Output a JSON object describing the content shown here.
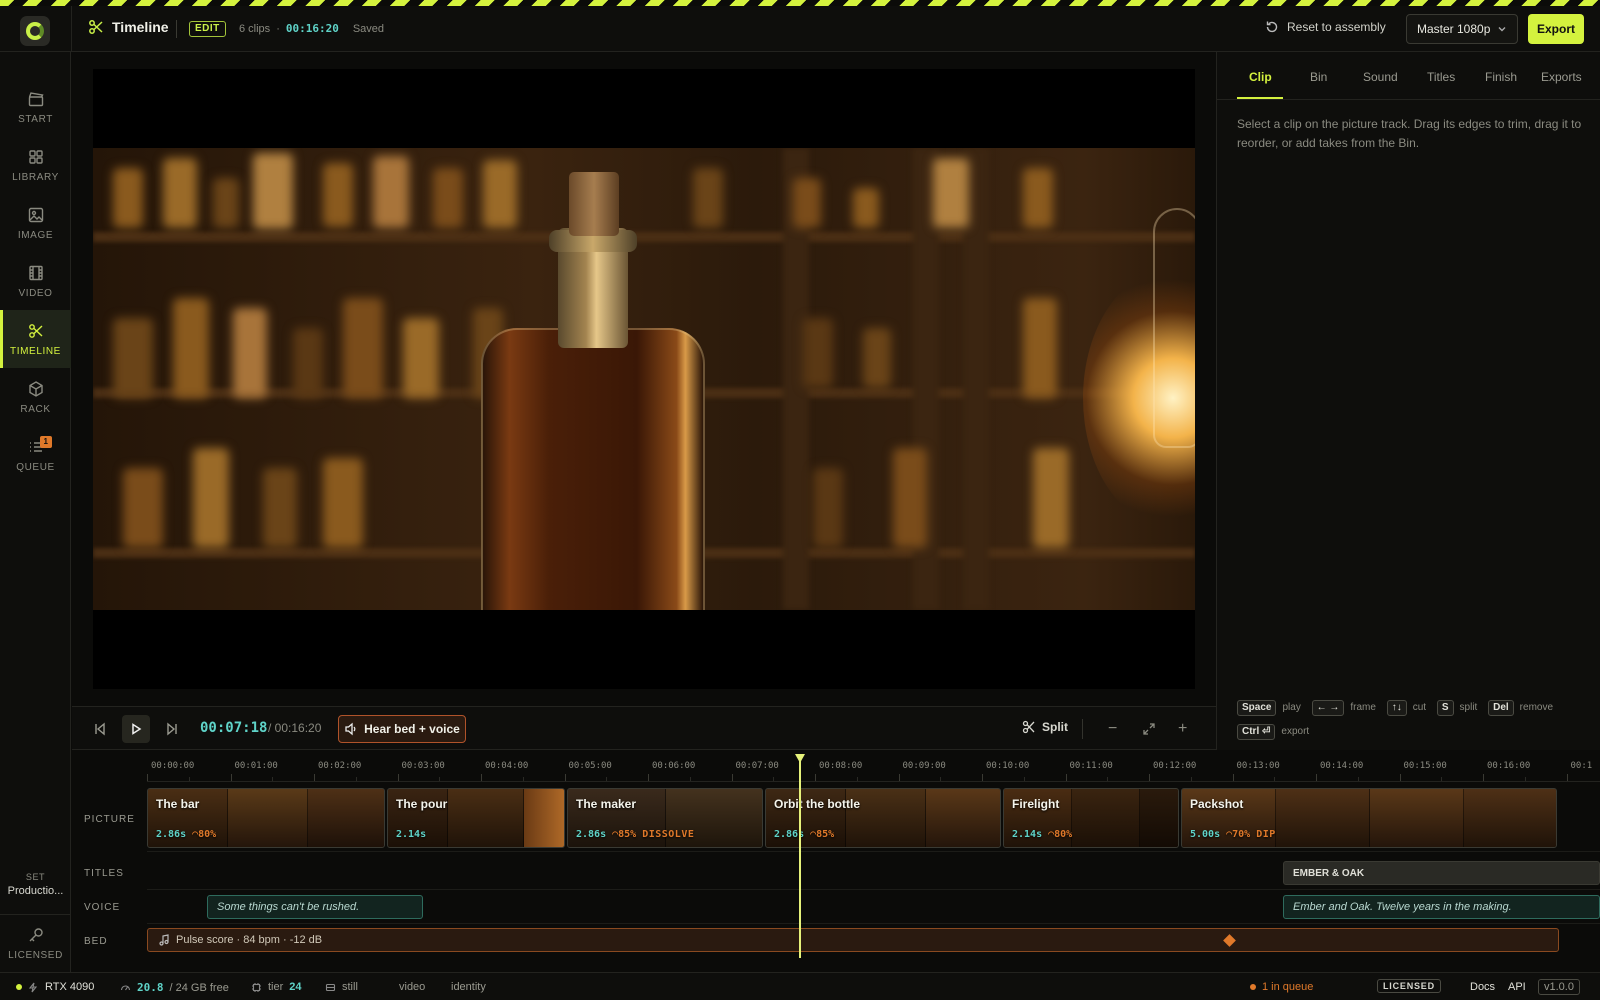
{
  "header": {
    "title": "Timeline",
    "mode_badge": "EDIT",
    "clip_count": "6 clips",
    "total_time": "00:16:20",
    "save_status": "Saved",
    "reset_label": "Reset to assembly",
    "preset": "Master 1080p",
    "export_label": "Export"
  },
  "sidebar": {
    "items": [
      {
        "label": "START",
        "icon": "clapper-icon"
      },
      {
        "label": "LIBRARY",
        "icon": "grid-icon"
      },
      {
        "label": "IMAGE",
        "icon": "image-icon"
      },
      {
        "label": "VIDEO",
        "icon": "film-icon"
      },
      {
        "label": "TIMELINE",
        "icon": "scissors-icon",
        "active": true
      },
      {
        "label": "RACK",
        "icon": "cube-icon"
      },
      {
        "label": "QUEUE",
        "icon": "list-icon",
        "badge": "1"
      }
    ],
    "set_label": "SET",
    "set_value": "Productio...",
    "license_label": "LICENSED"
  },
  "panel": {
    "tabs": [
      "Clip",
      "Bin",
      "Sound",
      "Titles",
      "Finish",
      "Exports"
    ],
    "active_tab": "Clip",
    "hint": "Select a clip on the picture track. Drag its edges to trim, drag it to reorder, or add takes from the Bin.",
    "shortcuts": [
      {
        "key": "Space",
        "action": "play"
      },
      {
        "key": "← →",
        "action": "frame"
      },
      {
        "key": "↑↓",
        "action": "cut"
      },
      {
        "key": "S",
        "action": "split"
      },
      {
        "key": "Del",
        "action": "remove"
      },
      {
        "key": "Ctrl ⏎",
        "action": "export"
      }
    ]
  },
  "transport": {
    "timecode": "00:07:18",
    "duration": "/ 00:16:20",
    "audio_toggle": "Hear bed + voice",
    "split_label": "Split"
  },
  "timeline": {
    "ruler": [
      "00:00:00",
      "00:01:00",
      "00:02:00",
      "00:03:00",
      "00:04:00",
      "00:05:00",
      "00:06:00",
      "00:07:00",
      "00:08:00",
      "00:09:00",
      "00:10:00",
      "00:11:00",
      "00:12:00",
      "00:13:00",
      "00:14:00",
      "00:15:00",
      "00:16:00",
      "00:1"
    ],
    "tracks": {
      "picture": "PICTURE",
      "titles": "TITLES",
      "voice": "VOICE",
      "bed": "BED"
    },
    "clips": [
      {
        "name": "The bar",
        "duration": "2.86s",
        "speed": "◠80%",
        "transition": ""
      },
      {
        "name": "The pour",
        "duration": "2.14s",
        "speed": "",
        "transition": ""
      },
      {
        "name": "The maker",
        "duration": "2.86s",
        "speed": "◠85%",
        "transition": "DISSOLVE"
      },
      {
        "name": "Orbit the bottle",
        "duration": "2.86s",
        "speed": "◠85%",
        "transition": ""
      },
      {
        "name": "Firelight",
        "duration": "2.14s",
        "speed": "◠80%",
        "transition": ""
      },
      {
        "name": "Packshot",
        "duration": "5.00s",
        "speed": "◠70%",
        "transition": "DIP"
      }
    ],
    "title_clip": "EMBER & OAK",
    "voice_clips": [
      "Some things can't be rushed.",
      "Ember and Oak. Twelve years in the making."
    ],
    "bed_clip": "Pulse score · 84 bpm · -12 dB"
  },
  "status": {
    "gpu": "RTX 4090",
    "vram_used": "20.8",
    "vram_total": "/ 24 GB free",
    "tier_label": "tier",
    "tier_value": "24",
    "modes": [
      "still",
      "video",
      "identity"
    ],
    "queue": "1 in queue",
    "license": "LICENSED",
    "docs": "Docs",
    "api": "API",
    "version": "v1.0.0"
  },
  "colors": {
    "accent": "#d4f23e",
    "timecode": "#5fd3c8",
    "warn": "#e0792a"
  }
}
